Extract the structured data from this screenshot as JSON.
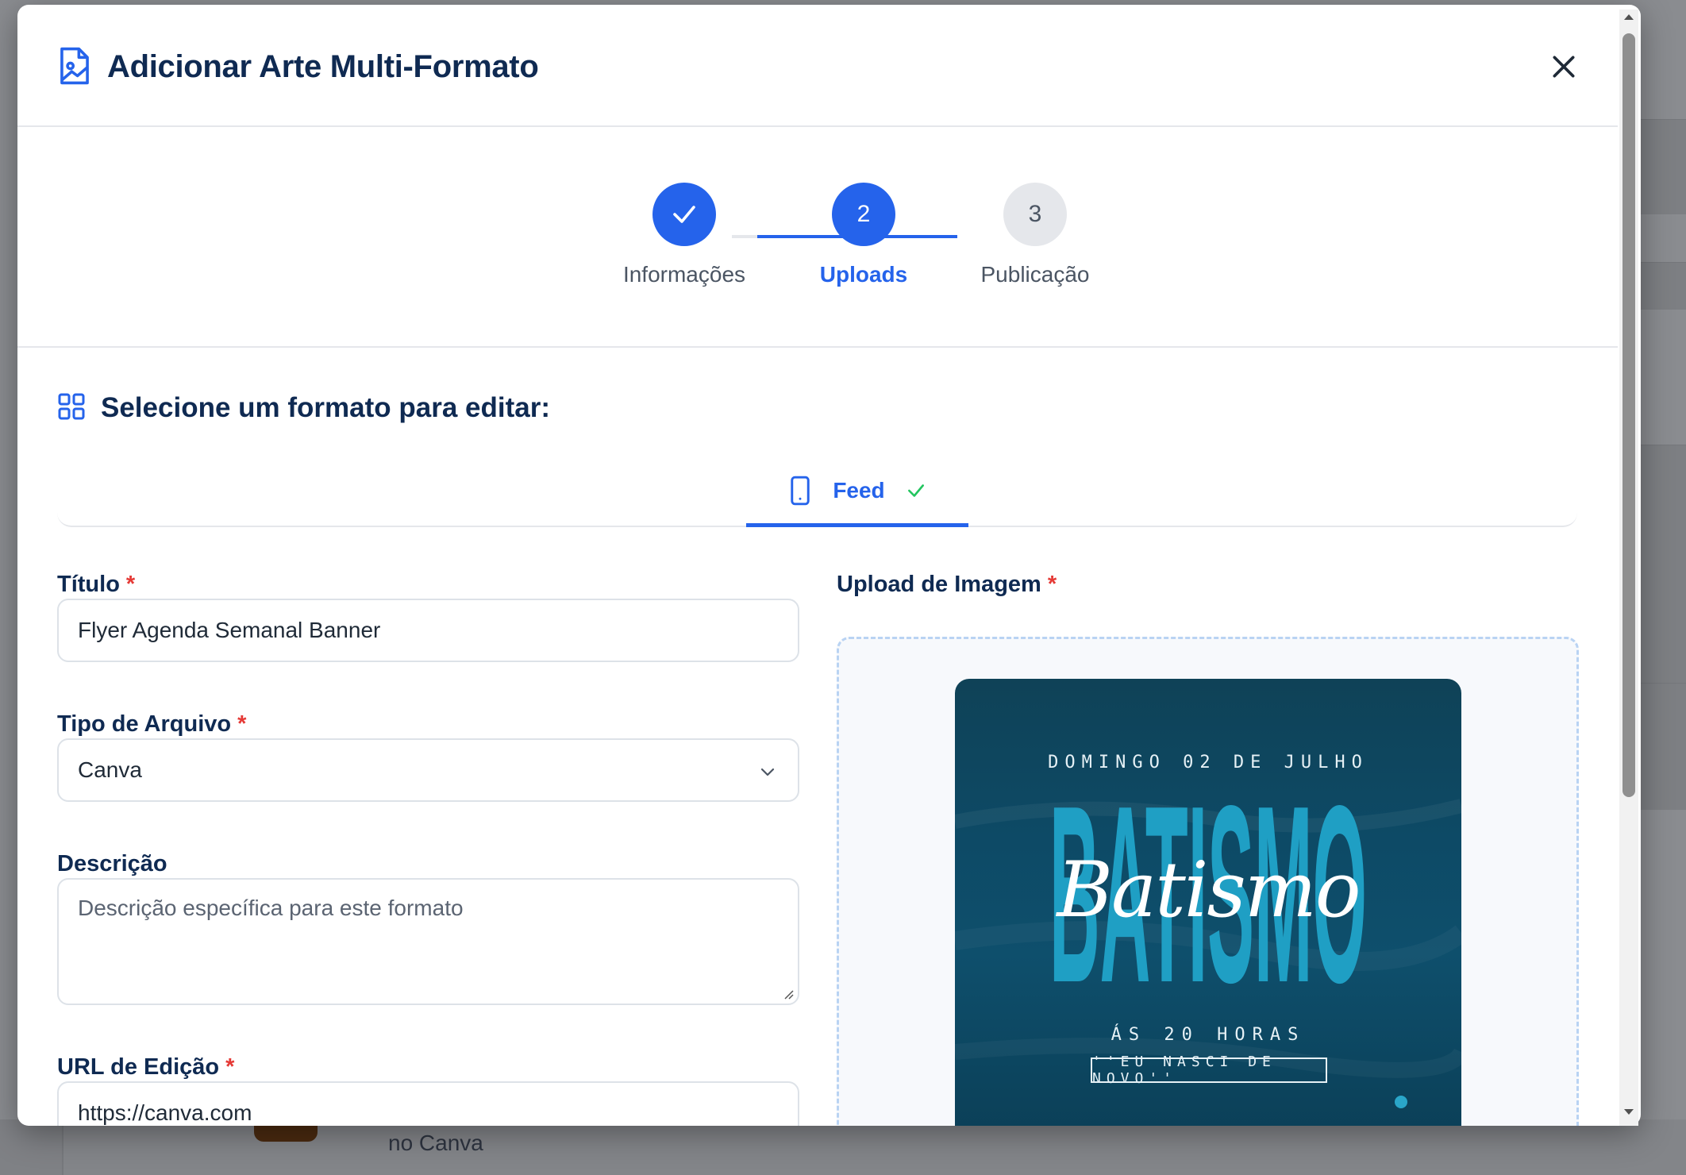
{
  "modal": {
    "title": "Adicionar Arte Multi-Formato",
    "close_label": "×"
  },
  "stepper": {
    "steps": [
      {
        "number": "1",
        "label": "Informações",
        "status": "complete"
      },
      {
        "number": "2",
        "label": "Uploads",
        "status": "active"
      },
      {
        "number": "3",
        "label": "Publicação",
        "status": "pending"
      }
    ]
  },
  "format_section": {
    "title": "Selecione um formato para editar:",
    "tabs": [
      {
        "label": "Feed",
        "completed": true,
        "icon": "smartphone-icon"
      }
    ]
  },
  "form": {
    "title_label": "Título",
    "title_value": "Flyer Agenda Semanal Banner",
    "file_type_label": "Tipo de Arquivo",
    "file_type_value": "Canva",
    "description_label": "Descrição",
    "description_placeholder": "Descrição específica para este formato",
    "url_label": "URL de Edição",
    "url_value": "https://canva.com",
    "required_mark": "*"
  },
  "upload": {
    "label": "Upload de Imagem",
    "preview": {
      "date": "DOMINGO 02 DE JULHO",
      "big_word": "BATISMO",
      "script_word": "Batismo",
      "time": "ÁS 20 HORAS",
      "quote": "''EU NASCI DE NOVO''"
    }
  },
  "background": {
    "text": "no Canva"
  },
  "colors": {
    "primary": "#2563eb",
    "heading": "#0f2a52",
    "success": "#22c55e",
    "required": "#e53935"
  }
}
